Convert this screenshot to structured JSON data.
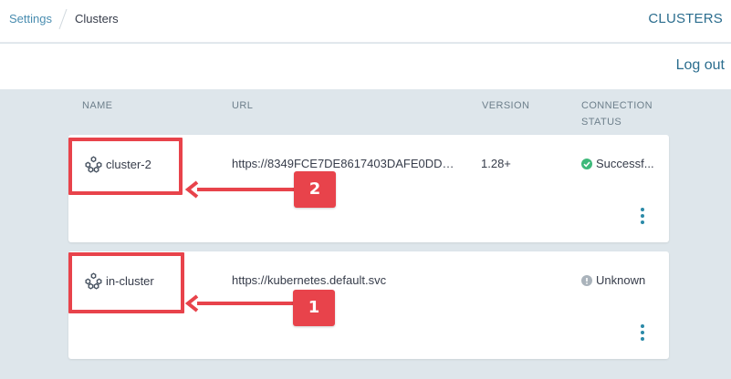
{
  "breadcrumb": {
    "parent": "Settings",
    "current": "Clusters"
  },
  "header": {
    "title": "CLUSTERS",
    "logout_label": "Log out"
  },
  "table": {
    "columns": {
      "name": "NAME",
      "url": "URL",
      "version": "VERSION",
      "status_line1": "CONNECTION",
      "status_line2": "STATUS"
    },
    "rows": [
      {
        "name": "cluster-2",
        "url": "https://8349FCE7DE8617403DAFE0DDD...",
        "version": "1.28+",
        "status": "Successf...",
        "status_kind": "success"
      },
      {
        "name": "in-cluster",
        "url": "https://kubernetes.default.svc",
        "version": "",
        "status": "Unknown",
        "status_kind": "unknown"
      }
    ]
  },
  "annotations": {
    "badge_top": "2",
    "badge_bottom": "1"
  },
  "colors": {
    "accent": "#2b6d8e",
    "success": "#3eb97a",
    "unknown": "#aab3bb",
    "annotation": "#e8434b"
  },
  "icons": {
    "cluster": "cluster-icon",
    "kebab": "more-vertical-icon"
  }
}
